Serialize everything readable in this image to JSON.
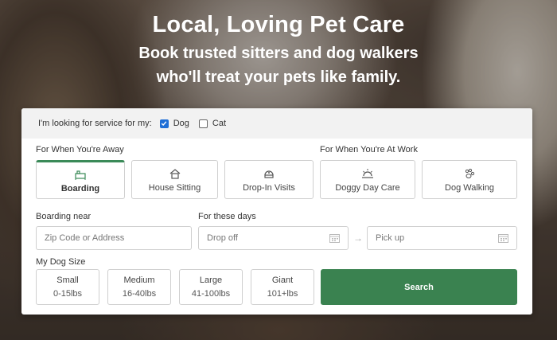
{
  "hero": {
    "title": "Local, Loving Pet Care",
    "subtitle_line1": "Book trusted sitters and dog walkers",
    "subtitle_line2": "who'll treat your pets like family."
  },
  "pet_selector": {
    "label": "I'm looking for service for my:",
    "options": [
      {
        "label": "Dog",
        "checked": true
      },
      {
        "label": "Cat",
        "checked": false
      }
    ]
  },
  "services": {
    "away_label": "For When You're Away",
    "work_label": "For When You're At Work",
    "items": [
      {
        "label": "Boarding",
        "icon": "boarding-icon",
        "active": true
      },
      {
        "label": "House Sitting",
        "icon": "house-icon",
        "active": false
      },
      {
        "label": "Drop-In Visits",
        "icon": "drop-in-icon",
        "active": false
      },
      {
        "label": "Doggy Day Care",
        "icon": "sun-icon",
        "active": false
      },
      {
        "label": "Dog Walking",
        "icon": "paw-icon",
        "active": false
      }
    ]
  },
  "location": {
    "label": "Boarding near",
    "placeholder": "Zip Code or Address"
  },
  "dates": {
    "label": "For these days",
    "drop_off_placeholder": "Drop off",
    "pick_up_placeholder": "Pick up"
  },
  "dog_size": {
    "label": "My Dog Size",
    "options": [
      {
        "name": "Small",
        "range": "0-15lbs"
      },
      {
        "name": "Medium",
        "range": "16-40lbs"
      },
      {
        "name": "Large",
        "range": "41-100lbs"
      },
      {
        "name": "Giant",
        "range": "101+lbs"
      }
    ]
  },
  "search": {
    "label": "Search"
  },
  "colors": {
    "accent_green": "#3a8250",
    "checkbox_blue": "#1f6fd6"
  }
}
